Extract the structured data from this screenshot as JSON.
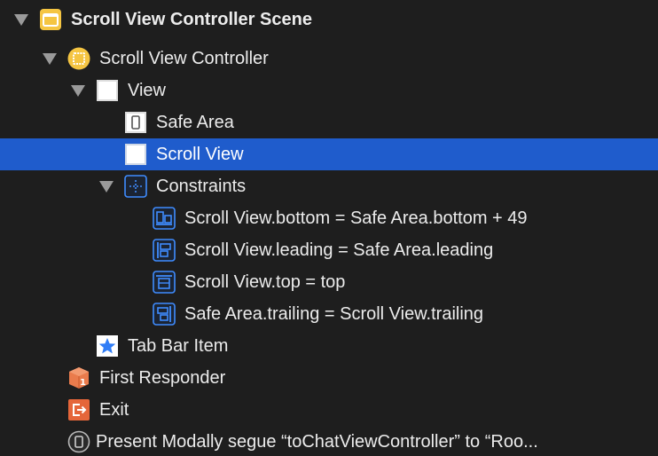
{
  "outline": {
    "scene": "Scroll View Controller Scene",
    "controller": "Scroll View Controller",
    "view": "View",
    "safe_area": "Safe Area",
    "scroll_view": "Scroll View",
    "constraints": "Constraints",
    "constraint_items": [
      "Scroll View.bottom = Safe Area.bottom + 49",
      "Scroll View.leading = Safe Area.leading",
      "Scroll View.top = top",
      "Safe Area.trailing = Scroll View.trailing"
    ],
    "tab_bar_item": "Tab Bar Item",
    "first_responder": "First Responder",
    "exit": "Exit",
    "segue": "Present Modally segue “toChatViewController” to “Roo..."
  },
  "icons": {
    "scene": "scene-icon",
    "controller": "view-controller-icon",
    "view": "view-icon",
    "safe_area": "safe-area-icon",
    "scroll_view": "scroll-view-icon",
    "constraints": "constraints-icon",
    "constraint_items": [
      "constraint-bottom-icon",
      "constraint-leading-icon",
      "constraint-top-icon",
      "constraint-trailing-icon"
    ],
    "tab_bar_item": "star-icon",
    "first_responder": "first-responder-icon",
    "exit": "exit-icon",
    "segue": "segue-icon"
  },
  "colors": {
    "background": "#1e1e1e",
    "selection": "#1f5ccc",
    "scene_yellow": "#f5c542",
    "constraint_blue": "#3f8cff",
    "first_responder_orange": "#e97b4c",
    "exit_orange": "#e5663a"
  },
  "selected_item": "Scroll View"
}
